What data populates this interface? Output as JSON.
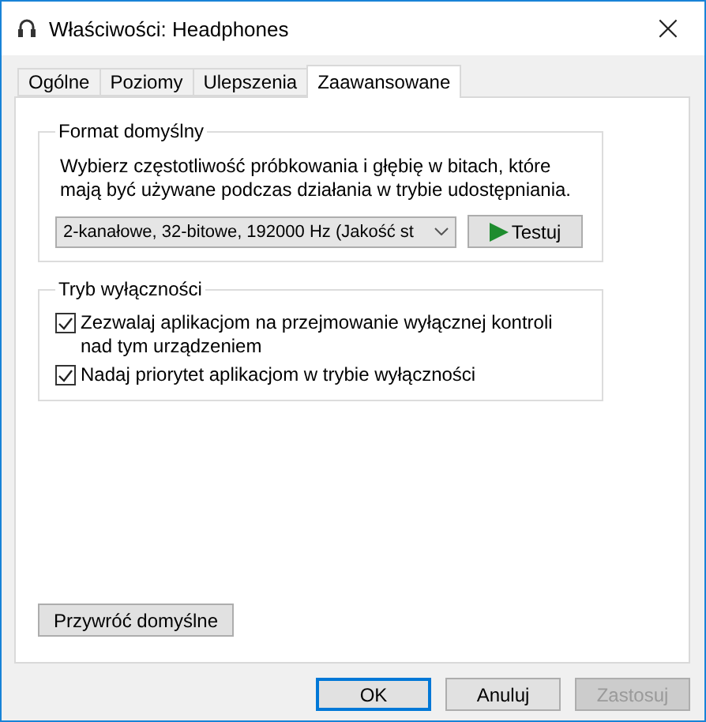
{
  "window": {
    "title": "Właściwości: Headphones",
    "close": "×"
  },
  "tabs": [
    {
      "label": "Ogólne",
      "selected": false
    },
    {
      "label": "Poziomy",
      "selected": false
    },
    {
      "label": "Ulepszenia",
      "selected": false
    },
    {
      "label": "Zaawansowane",
      "selected": true
    }
  ],
  "format_group": {
    "title": "Format domyślny",
    "description": "Wybierz częstotliwość próbkowania i głębię w bitach, które mają być używane podczas działania w trybie udostępniania.",
    "format_select": {
      "value": "2-kanałowe, 32-bitowe, 192000 Hz (Jakość st"
    },
    "test_button": "Testuj"
  },
  "exclusive_group": {
    "title": "Tryb wyłączności",
    "options": [
      {
        "label": "Zezwalaj aplikacjom na przejmowanie wyłącznej kontroli nad tym urządzeniem",
        "checked": true
      },
      {
        "label": "Nadaj priorytet aplikacjom w trybie wyłączności",
        "checked": true
      }
    ]
  },
  "restore_button": "Przywróć domyślne",
  "buttons": [
    {
      "label": "OK",
      "kind": "default",
      "disabled": false
    },
    {
      "label": "Anuluj",
      "kind": "normal",
      "disabled": false
    },
    {
      "label": "Zastosuj",
      "kind": "normal",
      "disabled": true
    }
  ]
}
